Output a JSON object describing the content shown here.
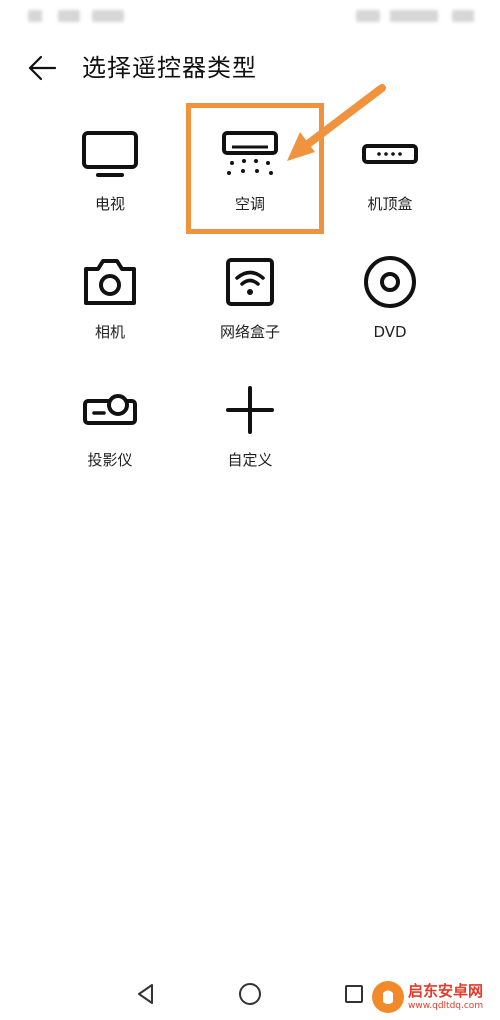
{
  "header": {
    "title": "选择遥控器类型"
  },
  "devices": [
    {
      "label": "电视",
      "icon": "tv-icon"
    },
    {
      "label": "空调",
      "icon": "air-conditioner-icon"
    },
    {
      "label": "机顶盒",
      "icon": "set-top-box-icon"
    },
    {
      "label": "相机",
      "icon": "camera-icon"
    },
    {
      "label": "网络盒子",
      "icon": "wifi-box-icon"
    },
    {
      "label": "DVD",
      "icon": "disc-icon"
    },
    {
      "label": "投影仪",
      "icon": "projector-icon"
    },
    {
      "label": "自定义",
      "icon": "plus-icon"
    }
  ],
  "annotation": {
    "color": "#f0933f"
  },
  "watermark": {
    "text": "启东安卓网",
    "url": "www.qdltdq.com",
    "color": "#e23b2b"
  }
}
